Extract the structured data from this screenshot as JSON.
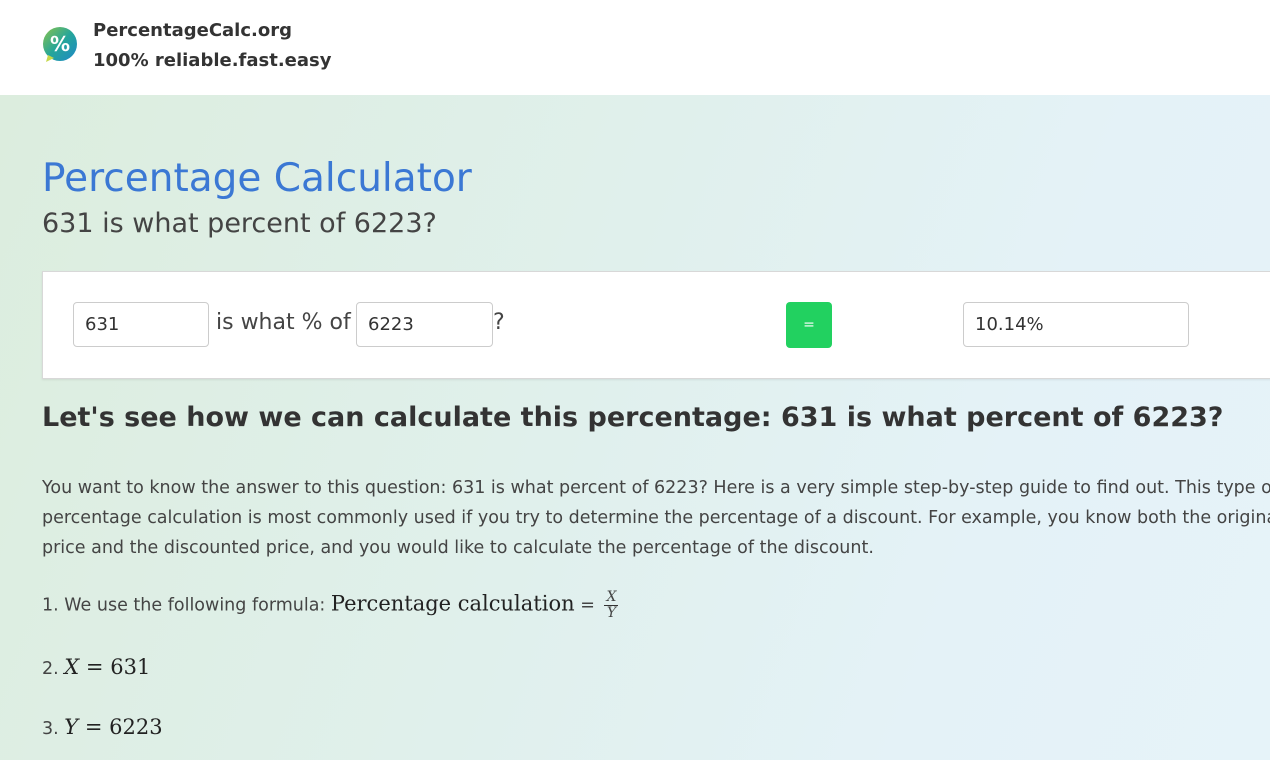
{
  "header": {
    "site_name": "PercentageCalc.org",
    "tagline": "100% reliable.fast.easy",
    "logo_symbol": "%"
  },
  "main": {
    "title": "Percentage Calculator",
    "subtitle": "631 is what percent of 6223?"
  },
  "calculator": {
    "x_value": "631",
    "middle_text": "is what % of",
    "y_value": "6223",
    "question_mark": "?",
    "equals_label": "=",
    "result": "10.14%",
    "equals_color": "#22d160"
  },
  "explanation": {
    "heading": "Let's see how we can calculate this percentage: 631 is what percent of 6223?",
    "intro_lines": [
      "You want to know the answer to this question: 631 is what percent of 6223? Here is a very simple step-by-step guide to find out. This type of",
      "percentage calculation is most commonly used if you try to determine the percentage of a discount. For example, you know both the original",
      "price and the discounted price, and you would like to calculate the percentage of the discount."
    ],
    "steps": [
      {
        "number": "1.",
        "text": "We use the following formula:",
        "formula_label": "Percentage calculation",
        "equals": "=",
        "frac_num": "X",
        "frac_den": "Y"
      },
      {
        "number": "2.",
        "var": "X",
        "equals": "=",
        "value": "631"
      },
      {
        "number": "3.",
        "var": "Y",
        "equals": "=",
        "value": "6223"
      }
    ]
  },
  "colors": {
    "title_blue": "#3b78d4",
    "button_green": "#22d160"
  }
}
